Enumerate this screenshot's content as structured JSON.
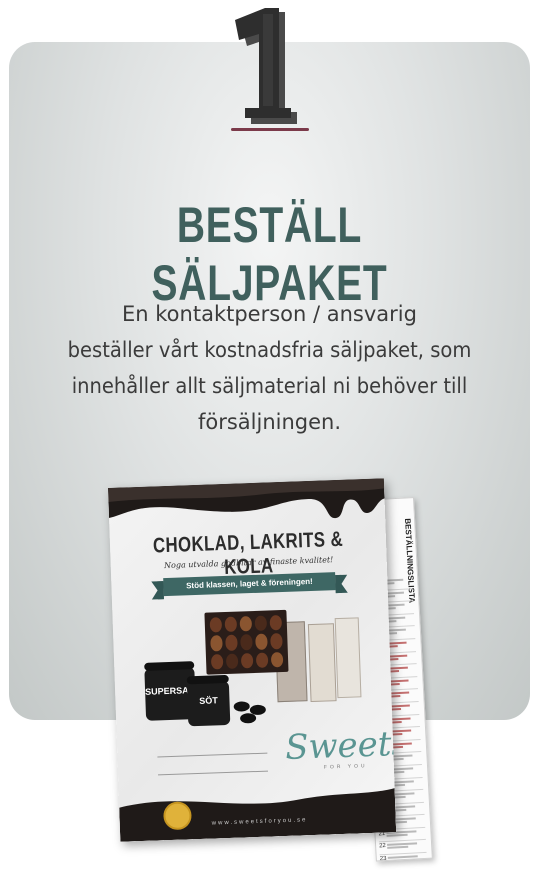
{
  "step": {
    "number": "1"
  },
  "title": "BESTÄLL SÄLJPAKET",
  "description": {
    "lines": [
      "En kontaktperson / ansvarig",
      "beställer vårt kostnadsfria säljpaket, som",
      "innehåller allt säljmaterial ni behöver till",
      "försäljningen."
    ]
  },
  "colors": {
    "title": "#40605d",
    "underline": "#7b3a4a",
    "card": "#d6dada",
    "banner": "#3e6764"
  },
  "product_image": {
    "poster": {
      "heading": "CHOKLAD, LAKRITS & KOLA",
      "subheading": "Noga utvalda godbitar av finaste kvalitet!",
      "banner": "Stöd klassen, laget & föreningen!",
      "jar1_label": "SUPERSALT",
      "jar2_label": "SÖT",
      "brand": "Sweets",
      "brand_sub": "FOR YOU",
      "url": "www.sweetsforyou.se"
    },
    "order_sheet": {
      "title": "BESTÄLLNINGSLISTA"
    }
  }
}
